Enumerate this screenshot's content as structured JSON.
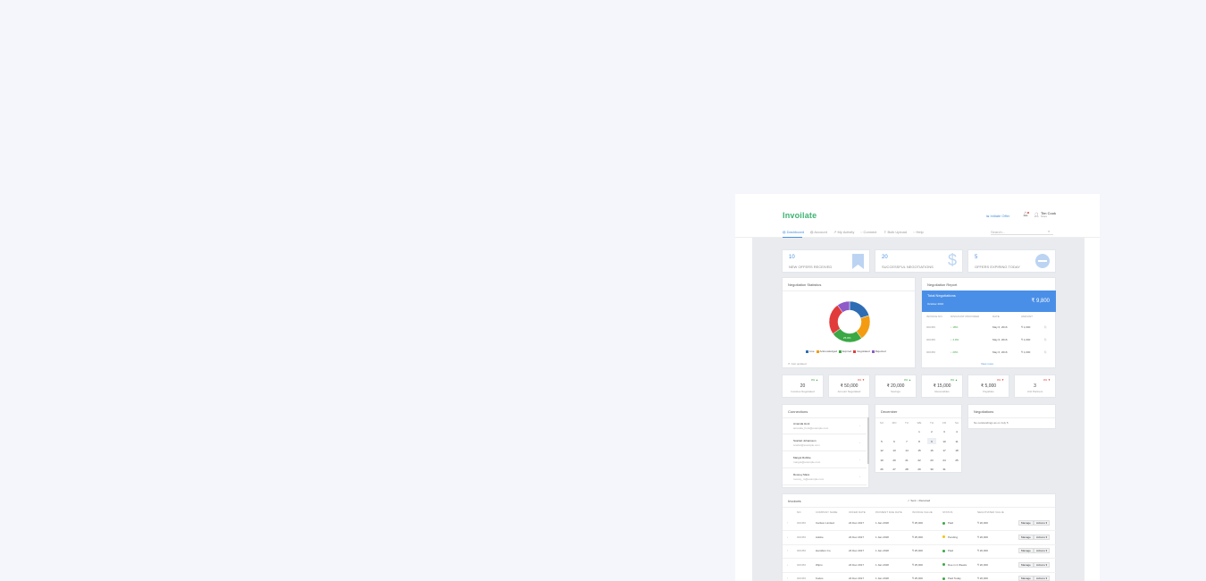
{
  "app": {
    "logo": "Invoilate"
  },
  "header": {
    "initiate_offer": "Initiate Offer",
    "user_name": "Tim Cook",
    "user_role": "Store"
  },
  "nav": {
    "items": [
      {
        "label": "Dashboard"
      },
      {
        "label": "Account"
      },
      {
        "label": "My Activity"
      },
      {
        "label": "Connect"
      },
      {
        "label": "Bulk Upload"
      },
      {
        "label": "Help"
      }
    ],
    "search_placeholder": "Search..."
  },
  "kpis": [
    {
      "value": "10",
      "label": "NEW OFFERS RECEIVED",
      "icon": "bookmark-icon"
    },
    {
      "value": "20",
      "label": "SUCCESSFUL NEGOTIATIONS",
      "icon": "dollar-icon"
    },
    {
      "value": "5",
      "label": "OFFERS EXPIRING TODAY",
      "icon": "minus-circle-icon"
    }
  ],
  "negotiation_statistics": {
    "title": "Negotiation Statistics",
    "footnote": "Just updated",
    "chart_data": {
      "type": "pie",
      "labels": [
        "Live",
        "Acknowledged",
        "Expired",
        "Negotiated",
        "Rejected"
      ],
      "values": [
        20,
        20,
        25,
        25,
        10
      ],
      "colors": [
        "#2e6db4",
        "#f39c12",
        "#3aa844",
        "#e23b3b",
        "#8e5bc8"
      ],
      "slice_labels": [
        "",
        "",
        "25.0%",
        "",
        ""
      ]
    }
  },
  "negotiation_report": {
    "title": "Negotiation Report",
    "banner_title": "Total Negotiations",
    "banner_sub": "October 2016",
    "banner_amount": "₹ 9,800",
    "columns": [
      "INVOICE NO.",
      "DISCOUNT PROVIDED",
      "DATE",
      "AMOUNT"
    ],
    "rows": [
      {
        "invoice": "000456",
        "discount": "↓ 18%",
        "date": "May 6, 2016",
        "amount": "₹ 1,000"
      },
      {
        "invoice": "000456",
        "discount": "↓ 4.9%",
        "date": "May 6, 2016",
        "amount": "₹ 1,000"
      },
      {
        "invoice": "000456",
        "discount": "↓ 20%",
        "date": "May 6, 2016",
        "amount": "₹ 1,000"
      }
    ],
    "link": "View more"
  },
  "stats": [
    {
      "value": "20",
      "label": "Invoices Negotiated",
      "delta": "0% ▲",
      "delta_color": "#3aa844"
    },
    {
      "value": "₹ 50,000",
      "label": "Amount Negotiated",
      "delta": "0% ▼",
      "delta_color": "#e23b3b"
    },
    {
      "value": "₹ 20,000",
      "label": "Savings",
      "delta": "0% ▲",
      "delta_color": "#3aa844"
    },
    {
      "value": "₹ 15,000",
      "label": "Receivables",
      "delta": "0% ▲",
      "delta_color": "#3aa844"
    },
    {
      "value": "₹ 5,000",
      "label": "Payables",
      "delta": "0% ▼",
      "delta_color": "#e23b3b"
    },
    {
      "value": "3",
      "label": "Unit Partners",
      "delta": "0% ▼",
      "delta_color": "#e23b3b"
    }
  ],
  "connections": {
    "title": "Connections",
    "items": [
      {
        "name": "Amanda Hunt",
        "email": "amanda_hunt@example.com"
      },
      {
        "name": "Scarlett Johansson",
        "email": "scarlet@example.com"
      },
      {
        "name": "Margot Robbie",
        "email": "margot@example.com"
      },
      {
        "name": "Rooney Mara",
        "email": "rooney_m@example.com"
      }
    ]
  },
  "calendar": {
    "title": "December",
    "weekdays": [
      "SU",
      "MO",
      "TU",
      "WE",
      "TH",
      "FR",
      "SA"
    ],
    "weeks": [
      [
        "",
        "",
        "",
        "1",
        "2",
        "3",
        "4"
      ],
      [
        "5",
        "6",
        "7",
        "8",
        "9",
        "10",
        "11"
      ],
      [
        "12",
        "13",
        "14",
        "15",
        "16",
        "17",
        "18"
      ],
      [
        "19",
        "20",
        "21",
        "22",
        "23",
        "24",
        "25"
      ],
      [
        "26",
        "27",
        "28",
        "29",
        "30",
        "31",
        ""
      ]
    ],
    "selected": "9"
  },
  "negotiations_panel": {
    "title": "Negotiations",
    "text": "No outstandings as on July 5"
  },
  "invoices": {
    "title": "Invoices",
    "received_summary": "✓ Sent  ↓ Received",
    "columns": [
      "NO.",
      "COMPANY NAME",
      "OFFER DATE",
      "PAYMENT DUE DATE",
      "INVOICE VALUE",
      "STATUS",
      "NEGOTIATED VALUE"
    ],
    "rows": [
      {
        "no": "000456",
        "company": "Carlson Limited",
        "offer": "24 Dec 2017",
        "due": "1 Jan 2018",
        "value": "₹ 25,000",
        "status": "Paid",
        "status_color": "#3aa844",
        "negotiated": "₹ 20,000"
      },
      {
        "no": "000456",
        "company": "Adobe",
        "offer": "24 Dec 2017",
        "due": "1 Jan 2018",
        "value": "₹ 25,000",
        "status": "Pending",
        "status_color": "#f1c40f",
        "negotiated": "₹ 20,000"
      },
      {
        "no": "000456",
        "company": "Hamilton Co.",
        "offer": "24 Dec 2017",
        "due": "1 Jan 2018",
        "value": "₹ 25,000",
        "status": "Paid",
        "status_color": "#3aa844",
        "negotiated": "₹ 20,000"
      },
      {
        "no": "000456",
        "company": "Wipro",
        "offer": "24 Dec 2017",
        "due": "1 Jan 2018",
        "value": "₹ 25,000",
        "status": "Due in 2 Weeks",
        "status_color": "#3aa844",
        "negotiated": "₹ 20,000"
      },
      {
        "no": "000456",
        "company": "Kudos",
        "offer": "24 Dec 2017",
        "due": "1 Jan 2018",
        "value": "₹ 25,000",
        "status": "Paid Today",
        "status_color": "#3aa844",
        "negotiated": "₹ 20,000"
      }
    ],
    "manage_label": "Manage",
    "actions_label": "Actions ▾"
  }
}
